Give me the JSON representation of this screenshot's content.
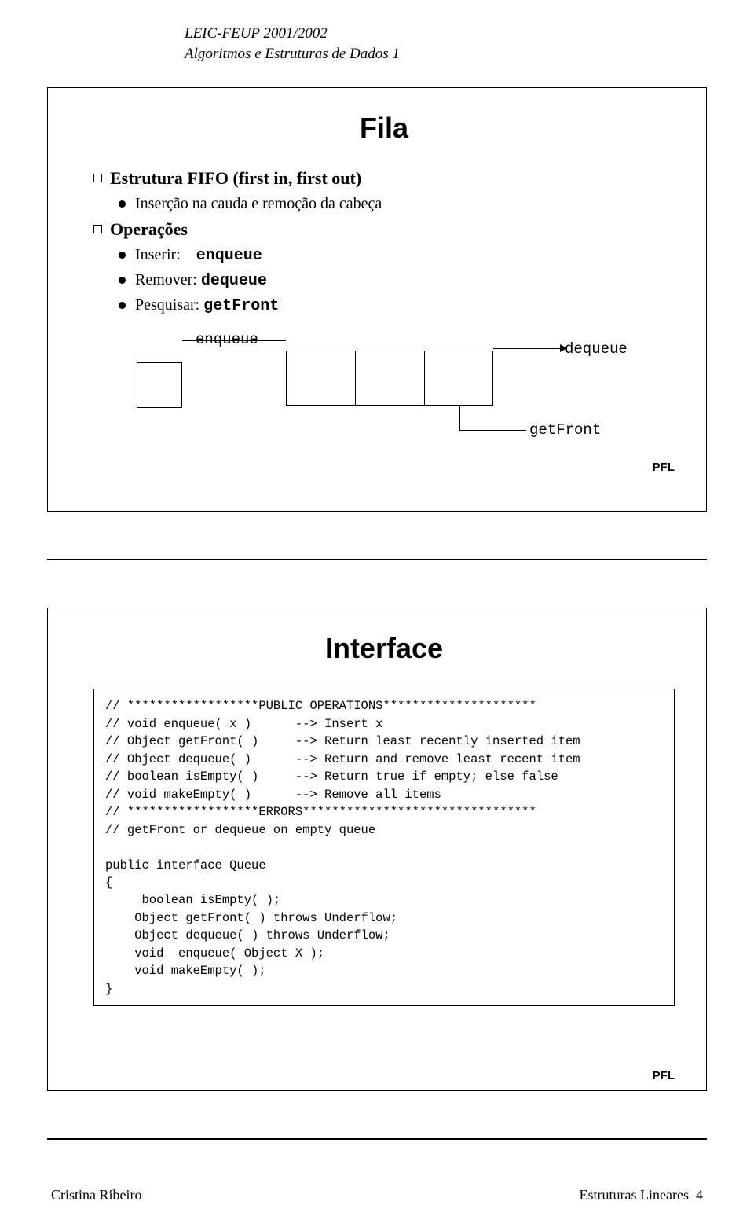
{
  "header": {
    "line1": "LEIC-FEUP 2001/2002",
    "line2": "Algoritmos e Estruturas de Dados 1"
  },
  "slide1": {
    "title": "Fila",
    "b1": "Estrutura FIFO (first in, first out)",
    "b1d1": "Inserção na cauda e remoção da cabeça",
    "b2": "Operações",
    "op_ins_label": "Inserir:",
    "op_ins_cmd": "enqueue",
    "op_rem_label": "Remover:",
    "op_rem_cmd": "dequeue",
    "op_pes_label": "Pesquisar:",
    "op_pes_cmd": "getFront",
    "diagram": {
      "enq": "enqueue",
      "deq": "dequeue",
      "gf": "getFront"
    },
    "tag": "PFL"
  },
  "slide2": {
    "title": "Interface",
    "code": "// ******************PUBLIC OPERATIONS*********************\n// void enqueue( x )      --> Insert x\n// Object getFront( )     --> Return least recently inserted item\n// Object dequeue( )      --> Return and remove least recent item\n// boolean isEmpty( )     --> Return true if empty; else false\n// void makeEmpty( )      --> Remove all items\n// ******************ERRORS********************************\n// getFront or dequeue on empty queue\n\npublic interface Queue\n{\n     boolean isEmpty( );\n    Object getFront( ) throws Underflow;\n    Object dequeue( ) throws Underflow;\n    void  enqueue( Object X );\n    void makeEmpty( );\n}",
    "tag": "PFL"
  },
  "footer": {
    "left": "Cristina Ribeiro",
    "right_text": "Estruturas Lineares",
    "right_num": "4"
  }
}
